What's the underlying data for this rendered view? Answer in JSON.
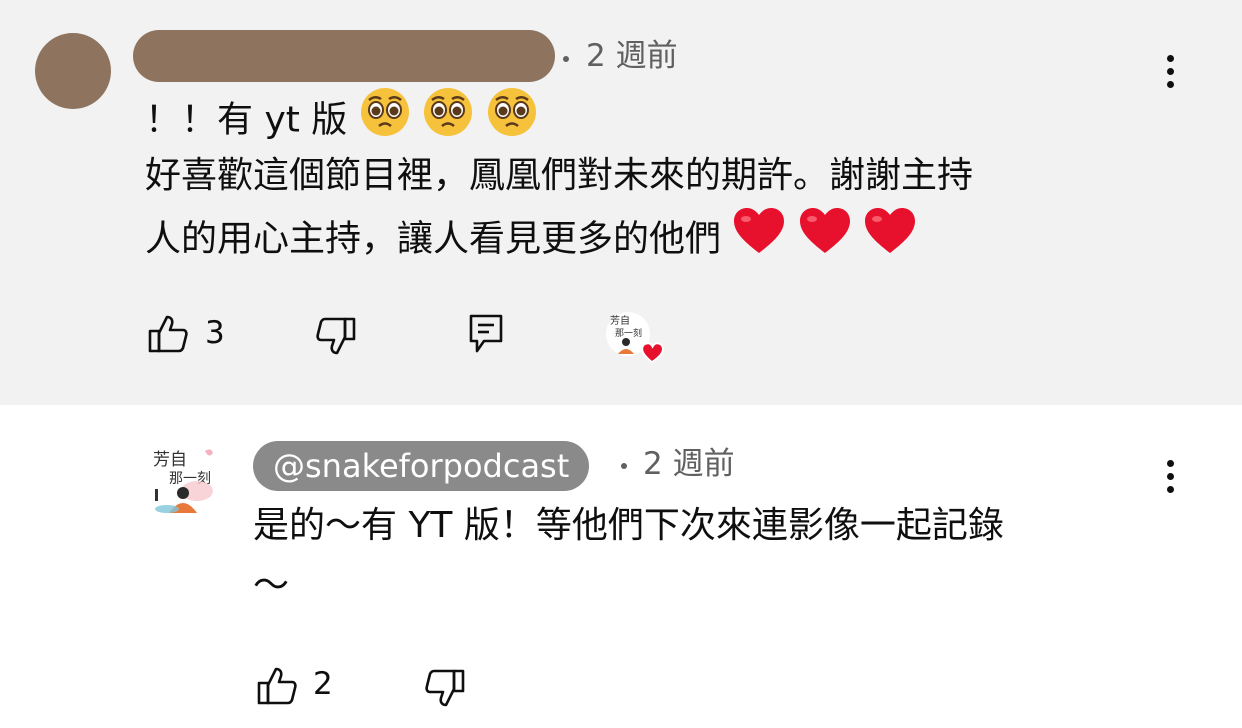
{
  "top_comment": {
    "timestamp": "2 週前",
    "line1_prefix": "！！有 yt 版",
    "line2": "好喜歡這個節目裡，鳳凰們對未來的期許。謝謝主持",
    "line3": "人的用心主持，讓人看見更多的他們",
    "like_count": "3",
    "icons": [
      "pleading-face-emoji",
      "red-heart-emoji",
      "thumbs-up-icon",
      "thumbs-down-icon",
      "reply-icon",
      "creator-heart-badge",
      "more-vert-icon"
    ]
  },
  "reply": {
    "handle": "@snakeforpodcast",
    "timestamp": "2 週前",
    "line1": "是的～有 YT 版！等他們下次來連影像一起記錄",
    "line2": "～",
    "like_count": "2"
  },
  "avatar": {
    "logo_text_line1": "芳自",
    "logo_text_line2": "那一刻"
  },
  "colors": {
    "highlight_bg": "#f2f2f2",
    "redaction": "#8e735f",
    "handle_pill": "#8a8a8a",
    "heart_red": "#e8112d"
  }
}
